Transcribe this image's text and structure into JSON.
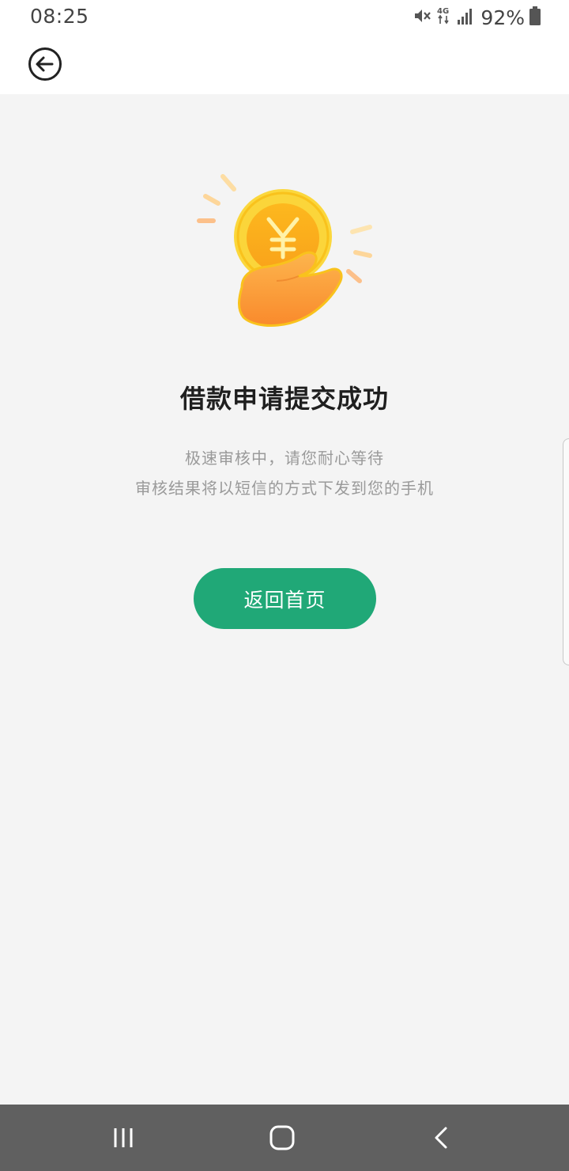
{
  "status_bar": {
    "time": "08:25",
    "network": "4G",
    "battery": "92%",
    "icons": [
      "mute-icon",
      "network-4g-icon",
      "signal-icon",
      "battery-icon"
    ]
  },
  "header": {
    "back_icon": "back-arrow-circle-icon"
  },
  "main": {
    "illustration": "coin-in-hand-illustration",
    "coin_symbol": "¥",
    "title": "借款申请提交成功",
    "description_line1": "极速审核中，请您耐心等待",
    "description_line2": "审核结果将以短信的方式下发到您的手机",
    "home_button_label": "返回首页"
  },
  "nav_bar": {
    "recent_icon": "recent-apps-icon",
    "home_icon": "home-icon",
    "back_icon": "back-icon"
  },
  "colors": {
    "accent": "#20a877",
    "coin": "#f9c21c",
    "hand": "#fb9a3c",
    "background": "#f4f4f4",
    "nav_bar": "#606060"
  }
}
